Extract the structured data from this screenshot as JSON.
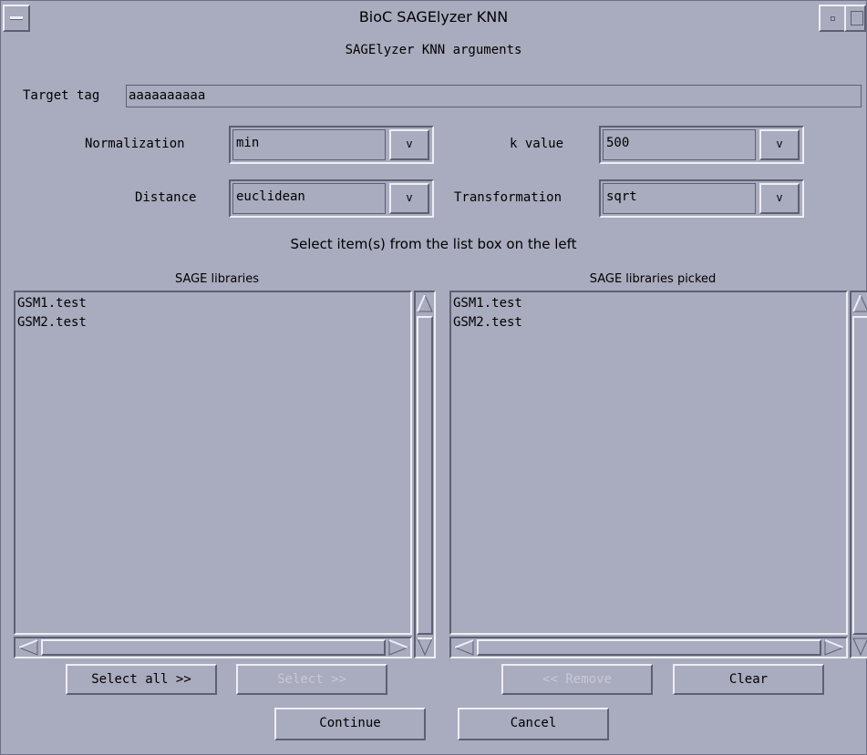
{
  "window": {
    "title": "BioC SAGElyzer KNN",
    "subtitle": "SAGElyzer KNN arguments"
  },
  "target_tag": {
    "label": "Target tag",
    "value": "aaaaaaaaaa"
  },
  "normalization": {
    "label": "Normalization",
    "value": "min",
    "arrow": "v"
  },
  "k_value": {
    "label": "k value",
    "value": "500",
    "arrow": "v"
  },
  "distance": {
    "label": "Distance",
    "value": "euclidean",
    "arrow": "v"
  },
  "transformation": {
    "label": "Transformation",
    "value": "sqrt",
    "arrow": "v"
  },
  "instruction": "Select item(s) from the list box on the left",
  "left_list": {
    "header": "SAGE libraries",
    "items": [
      "GSM1.test",
      "GSM2.test"
    ]
  },
  "right_list": {
    "header": "SAGE libraries picked",
    "items": [
      "GSM1.test",
      "GSM2.test"
    ]
  },
  "buttons": {
    "select_all": "Select all >>",
    "select": "Select >>",
    "remove": "<< Remove",
    "clear": "Clear",
    "continue": "Continue",
    "cancel": "Cancel"
  }
}
